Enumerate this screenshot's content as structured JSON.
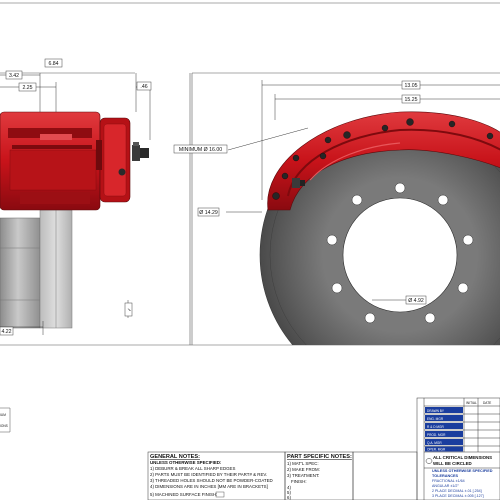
{
  "side_view": {
    "dims": {
      "overall_width": "6.84",
      "caliper_offset": "3.42",
      "body_width": "2.25",
      "bleeder_offset": ".46",
      "bottom_width": "4.22"
    }
  },
  "front_view": {
    "dims": {
      "caliper_span": "13.05",
      "rotor_span": "15.25",
      "minimum_diameter": "MINIMUM Ø 16.00",
      "rotor_diameter": "Ø 14.29",
      "bolt_circle": "Ø 4.92"
    }
  },
  "legend_fragment": [
    "IUM",
    "IONS"
  ],
  "general_notes": {
    "title": "GENERAL NOTES:",
    "subtitle": "UNLESS OTHERWISE SPECIFIED:",
    "items": [
      "1) DEBURR & BREAK ALL SHARP EDGES",
      "2) PARTS MUST BE IDENTIFIED BY THEIR PART# & REV.",
      "3) THREADED HOLES SHOULD NOT BE POWDER-COATED",
      "4) DIMENSIONS ARE IN INCHES [MM ARE IN BRACKETS]",
      "5) MACHINED SURFACE FINISH:"
    ]
  },
  "part_notes": {
    "title": "PART SPECIFIC NOTES:",
    "items": [
      "1) MAT'L SPEC:",
      "2) MAKE FROM:",
      "3) TREATMENT:",
      "FINISH:",
      "4)",
      "5)",
      "6)"
    ]
  },
  "critical_dims": {
    "line1": "ALL CRITICAL DIMENSIONS",
    "line2": "WILL BE CIRCLED"
  },
  "tolerances": {
    "header": "UNLESS OTHERWISE SPECIFIED",
    "title": "TOLERANCES",
    "lines": [
      "FRACTIONAL ±1/64",
      "ANGULAR ±1/2°",
      "2 PLACE DECIMAL ±.01 [.254]",
      "3 PLACE DECIMAL ±.005 [.127]"
    ]
  },
  "approvals": {
    "headers": [
      "INITIAL",
      "DATE"
    ],
    "rows": [
      "DRAWN BY",
      "ENG. MGR",
      "R & D MGR",
      "PROD. MGR",
      "Q.A. MGR",
      "OPER. MGR"
    ]
  },
  "colors": {
    "caliper_red": "#c8131a",
    "caliper_dark": "#7e0a0e",
    "caliper_light": "#e8363b",
    "rotor_gray": "#5f5f5f",
    "rotor_light": "#9c9c9c",
    "hub_gray": "#a9a9a9",
    "title_blue": "#1a3d9e"
  }
}
